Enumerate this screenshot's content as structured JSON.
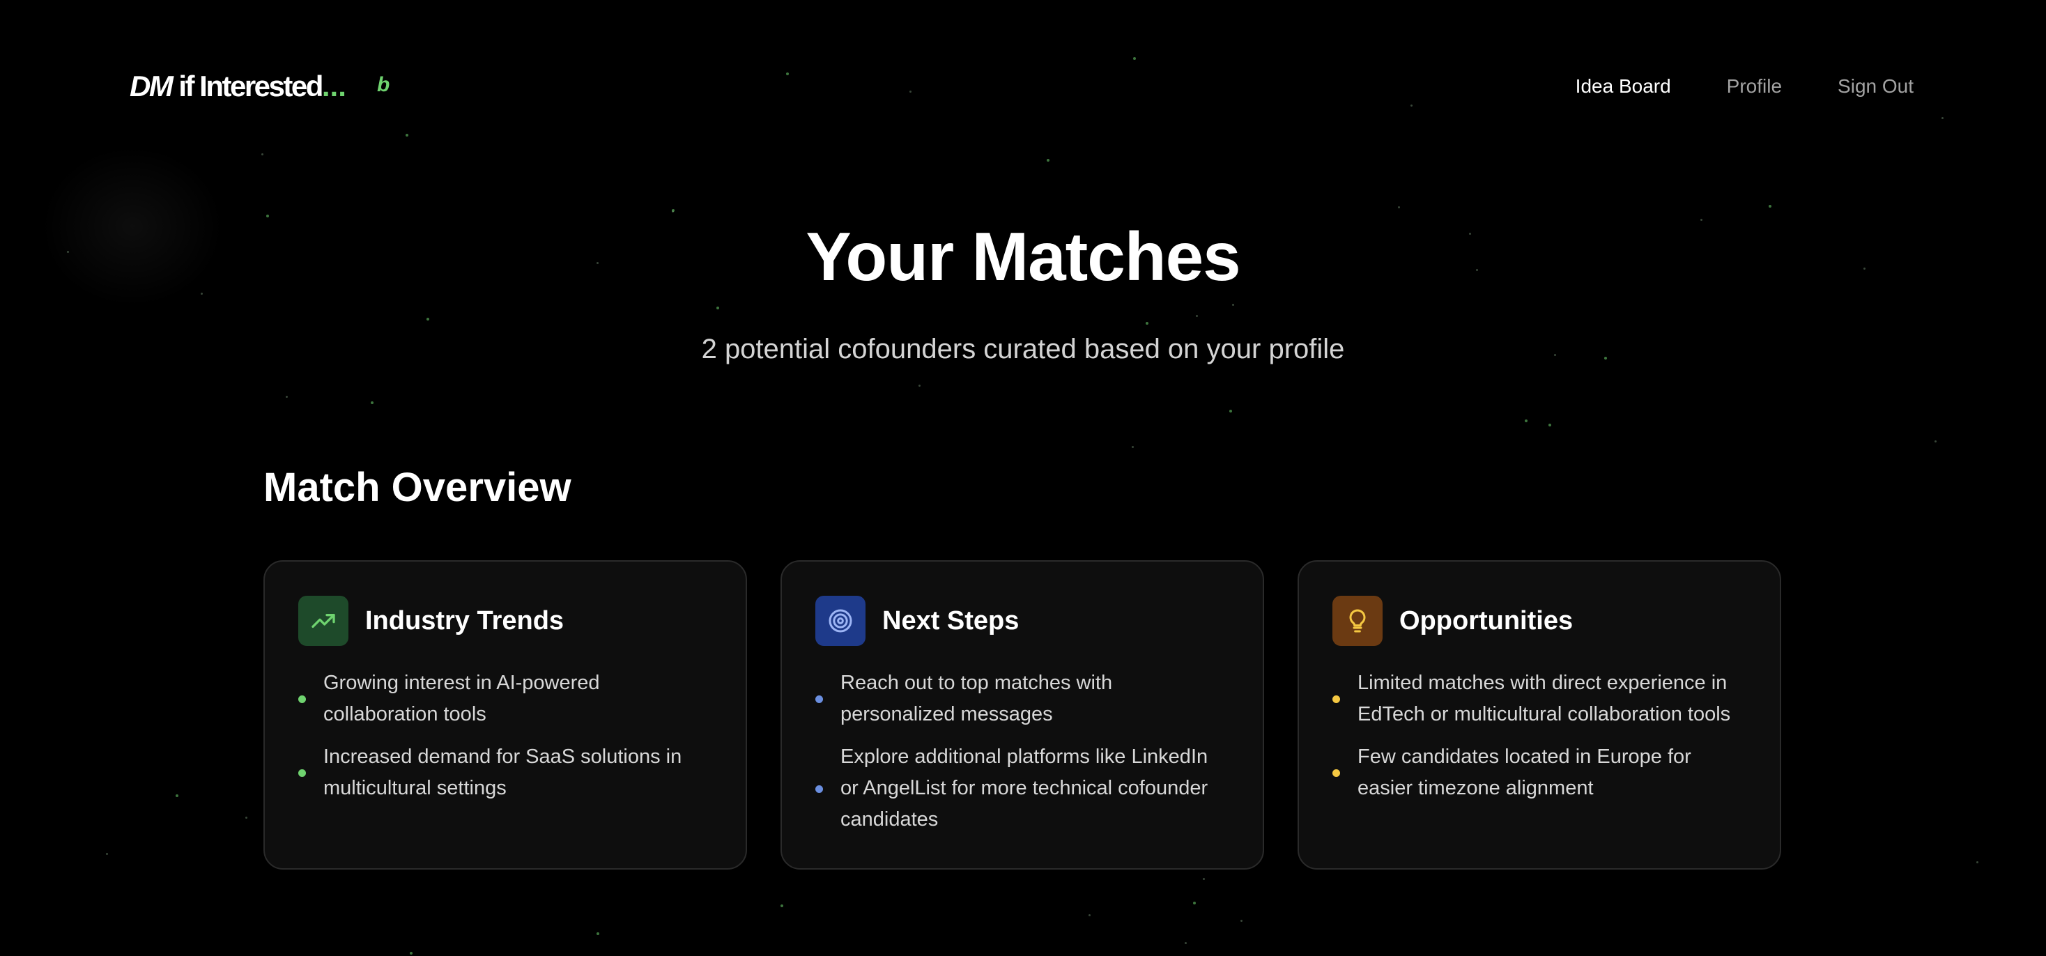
{
  "header": {
    "logo": {
      "prefix": "DM",
      "text": " if Interested",
      "dots": "...",
      "badge": "b"
    },
    "nav": [
      {
        "label": "Idea Board",
        "active": true
      },
      {
        "label": "Profile",
        "active": false
      },
      {
        "label": "Sign Out",
        "active": false
      }
    ]
  },
  "hero": {
    "title": "Your Matches",
    "subtitle": "2 potential cofounders curated based on your profile"
  },
  "overview": {
    "title": "Match Overview",
    "cards": [
      {
        "title": "Industry Trends",
        "icon": "trending-up-icon",
        "accent": "#6fd36f",
        "items": [
          "Growing interest in AI-powered collaboration tools",
          "Increased demand for SaaS solutions in multicultural settings"
        ]
      },
      {
        "title": "Next Steps",
        "icon": "target-icon",
        "accent": "#6b8fe0",
        "items": [
          "Reach out to top matches with personalized messages",
          "Explore additional platforms like LinkedIn or AngelList for more technical cofounder candidates"
        ]
      },
      {
        "title": "Opportunities",
        "icon": "lightbulb-icon",
        "accent": "#f5c842",
        "items": [
          "Limited matches with direct experience in EdTech or multicultural collaboration tools",
          "Few candidates located in Europe for easier timezone alignment"
        ]
      }
    ]
  },
  "colors": {
    "background": "#000000",
    "brand_green": "#6fd36f",
    "card_background": "#0e0e0e"
  }
}
